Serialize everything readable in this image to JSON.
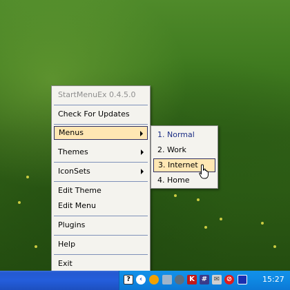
{
  "menu": {
    "title": "StartMenuEx 0.4.5.0",
    "items": [
      {
        "label": "Check For Updates"
      },
      {
        "label": "Menus"
      },
      {
        "label": "Themes"
      },
      {
        "label": "IconSets"
      },
      {
        "label": "Edit Theme"
      },
      {
        "label": "Edit Menu"
      },
      {
        "label": "Plugins"
      },
      {
        "label": "Help"
      },
      {
        "label": "Exit"
      }
    ]
  },
  "submenu": {
    "items": [
      {
        "label": "1. Normal"
      },
      {
        "label": "2. Work"
      },
      {
        "label": "3. Internet"
      },
      {
        "label": "4. Home"
      }
    ]
  },
  "taskbar": {
    "clock": "15:27",
    "tray_icons": [
      "help-icon",
      "collapse-arrow-icon",
      "orange-circle-icon",
      "network-icon",
      "user-icon",
      "shield-k-icon",
      "grid-icon",
      "envelope-icon",
      "no-entry-icon",
      "monitor-icon"
    ]
  },
  "colors": {
    "highlight": "#ffe7b3",
    "menu_bg": "#f4f3ee",
    "separator": "#7d90b8",
    "taskbar": "#245edb"
  }
}
